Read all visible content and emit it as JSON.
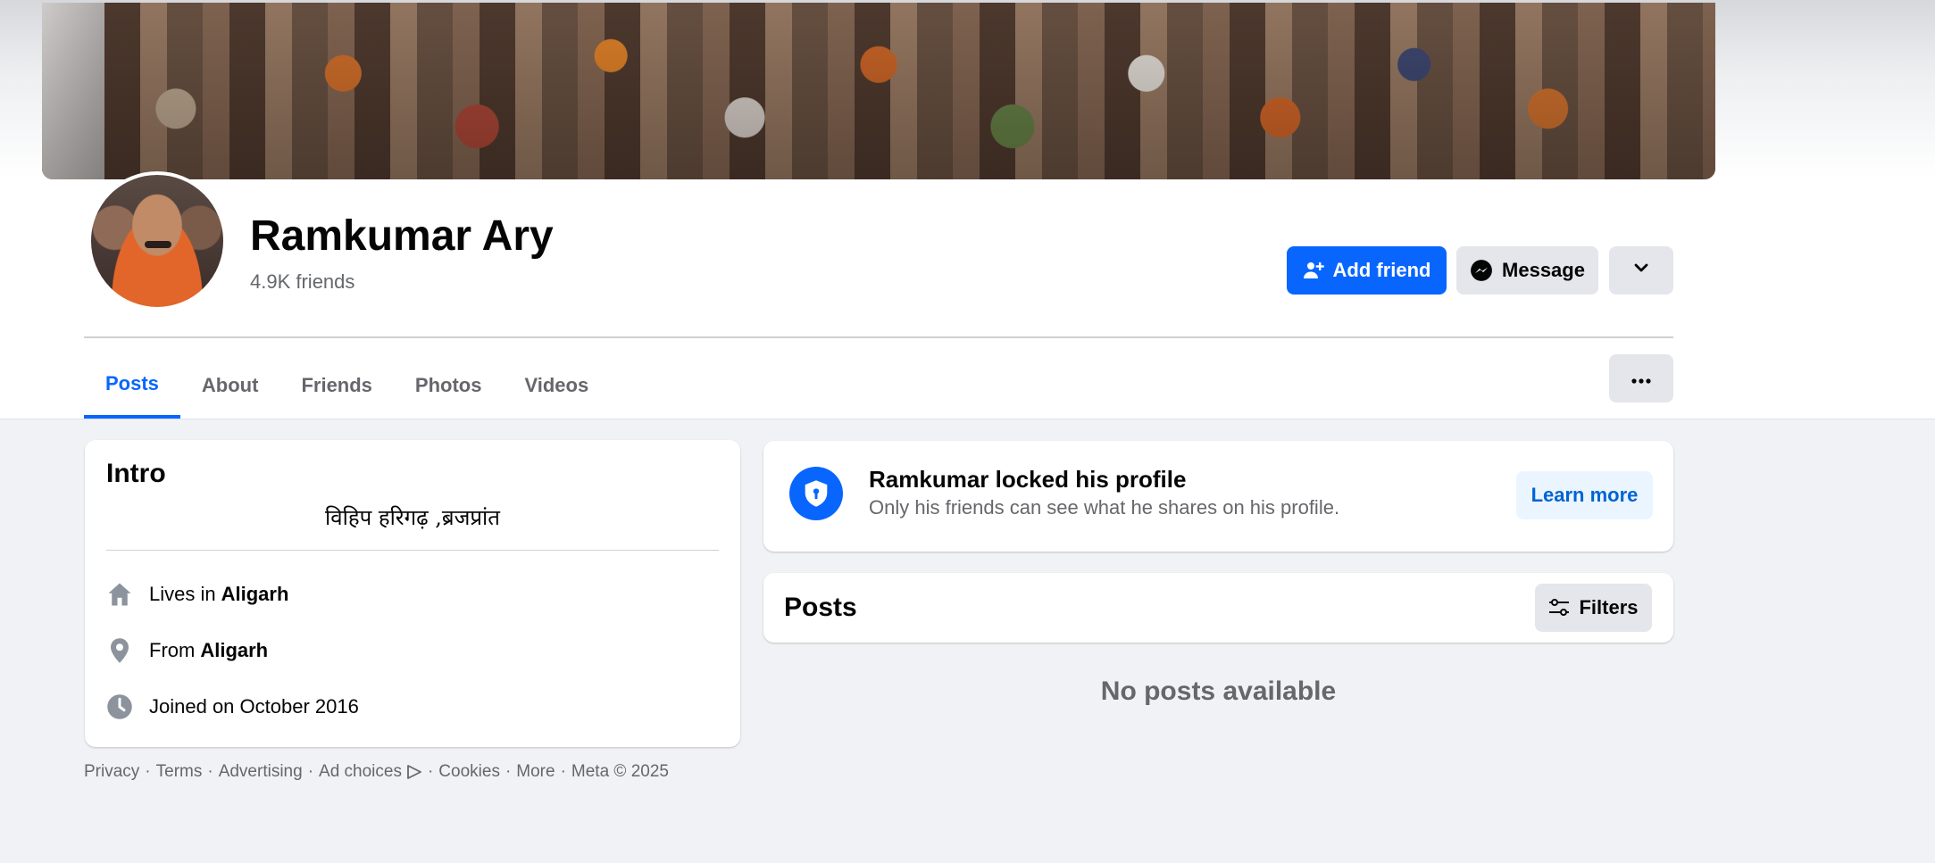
{
  "profile": {
    "name": "Ramkumar Ary",
    "friends_count": "4.9K friends"
  },
  "actions": {
    "add_friend": "Add friend",
    "message": "Message"
  },
  "tabs": [
    {
      "label": "Posts",
      "active": true
    },
    {
      "label": "About"
    },
    {
      "label": "Friends"
    },
    {
      "label": "Photos"
    },
    {
      "label": "Videos"
    }
  ],
  "intro": {
    "title": "Intro",
    "bio": "विहिप हरिगढ़ ,ब्रजप्रांत",
    "lives_prefix": "Lives in",
    "lives_value": "Aligarh",
    "from_prefix": "From",
    "from_value": "Aligarh",
    "joined": "Joined on October 2016"
  },
  "locked": {
    "title": "Ramkumar locked his profile",
    "subtitle": "Only his friends can see what he shares on his profile.",
    "learn_more": "Learn more"
  },
  "posts": {
    "title": "Posts",
    "filters": "Filters",
    "empty": "No posts available"
  },
  "footer": {
    "privacy": "Privacy",
    "terms": "Terms",
    "advertising": "Advertising",
    "ad_choices": "Ad choices",
    "cookies": "Cookies",
    "more": "More",
    "copyright": "Meta © 2025"
  },
  "colors": {
    "primary": "#0866ff",
    "background": "#f0f2f5",
    "secondary_text": "#65676b"
  }
}
